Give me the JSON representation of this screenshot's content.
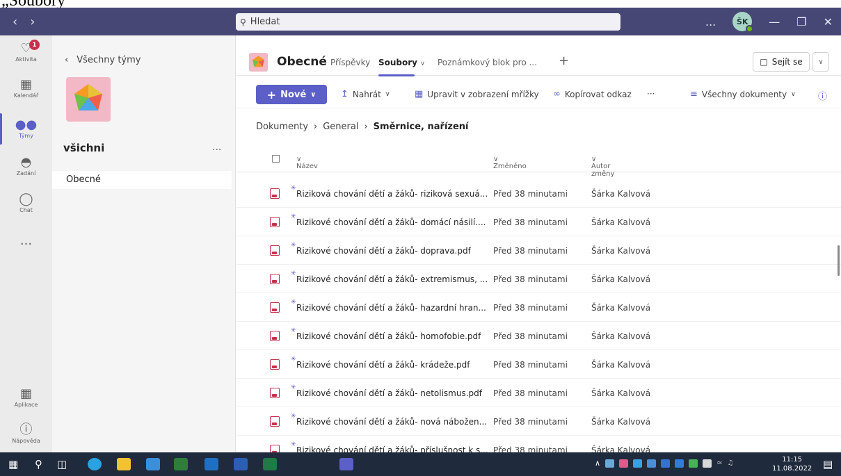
{
  "caption": "„Soubory",
  "search": {
    "placeholder": "Hledat"
  },
  "titlebar": {
    "more": "...",
    "avatar_initials": "ŠK"
  },
  "rail": {
    "items": [
      {
        "label": "Aktivita",
        "badge": "1"
      },
      {
        "label": "Kalendář"
      },
      {
        "label": "Týmy"
      },
      {
        "label": "Zadání"
      },
      {
        "label": "Chat"
      },
      {
        "label": "..."
      },
      {
        "label": "Aplikace"
      },
      {
        "label": "Nápověda"
      }
    ]
  },
  "teampane": {
    "back_label": "Všechny týmy",
    "team_name": "všichni",
    "more": "...",
    "channel": "Obecné"
  },
  "channel": {
    "name": "Obecné",
    "tabs": [
      "Příspěvky",
      "Soubory",
      "Poznámkový blok pro ..."
    ],
    "meet_label": "Sejít se"
  },
  "toolbar": {
    "new_label": "Nové",
    "upload_label": "Nahrát",
    "grid_label": "Upravit v zobrazení mřížky",
    "copy_link_label": "Kopírovat odkaz",
    "more": "···",
    "view_label": "Všechny dokumenty"
  },
  "breadcrumb": [
    "Dokumenty",
    "General",
    "Směrnice, nařízení"
  ],
  "columns": {
    "name": "Název",
    "modified": "Změněno",
    "author": "Autor změny"
  },
  "files": [
    {
      "name": "Riziková chování dětí a žáků- riziková sexuá...",
      "modified": "Před 38 minutami",
      "author": "Šárka Kalvová"
    },
    {
      "name": "Rizikové chování dětí a žáků- domácí násilí....",
      "modified": "Před 38 minutami",
      "author": "Šárka Kalvová"
    },
    {
      "name": "Rizikové chování dětí a žáků- doprava.pdf",
      "modified": "Před 38 minutami",
      "author": "Šárka Kalvová"
    },
    {
      "name": "Rizikové chování dětí a žáků- extremismus, ...",
      "modified": "Před 38 minutami",
      "author": "Šárka Kalvová"
    },
    {
      "name": "Rizikové chování dětí a žáků- hazardní hran...",
      "modified": "Před 38 minutami",
      "author": "Šárka Kalvová"
    },
    {
      "name": "Rizikové chování dětí a žáků- homofobie.pdf",
      "modified": "Před 38 minutami",
      "author": "Šárka Kalvová"
    },
    {
      "name": "Rizikové chování dětí a žáků- krádeže.pdf",
      "modified": "Před 38 minutami",
      "author": "Šárka Kalvová"
    },
    {
      "name": "Rizikové chování dětí a žáků- netolismus.pdf",
      "modified": "Před 38 minutami",
      "author": "Šárka Kalvová"
    },
    {
      "name": "Rizikové chování dětí a žáků- nová nábožen...",
      "modified": "Před 38 minutami",
      "author": "Šárka Kalvová"
    },
    {
      "name": "Rizikové chování dětí a žáků- příslušnost k s...",
      "modified": "Před 38 minutami",
      "author": "Šárka Kalvová"
    }
  ],
  "taskbar": {
    "time": "11:15",
    "date": "11.08.2022"
  },
  "colors": {
    "brand": "#464775",
    "accent": "#5b5fc7",
    "badge": "#c4314b",
    "taskbar": "#1f2a3d"
  }
}
